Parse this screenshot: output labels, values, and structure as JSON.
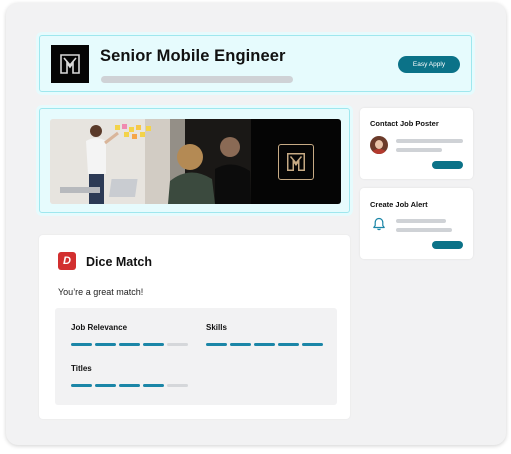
{
  "header": {
    "title": "Senior Mobile Engineer",
    "apply_label": "Easy Apply"
  },
  "sidebar": {
    "contact": {
      "title": "Contact Job Poster"
    },
    "alert": {
      "title": "Create Job Alert"
    }
  },
  "match": {
    "title": "Dice Match",
    "badge": "D",
    "subtitle": "You’re a great match!",
    "criteria": [
      {
        "label": "Job Relevance",
        "filled": 4,
        "total": 5
      },
      {
        "label": "Skills",
        "filled": 5,
        "total": 5
      },
      {
        "label": "Titles",
        "filled": 4,
        "total": 5
      }
    ]
  },
  "colors": {
    "accent": "#0b7288",
    "highlight_bg": "#e6fbfd",
    "highlight_border": "#9fe7ee",
    "dice_red": "#d22f2f",
    "segment_on": "#1b86a7",
    "segment_off": "#d5d7da"
  },
  "icons": {
    "company_logo": "company-logo-icon",
    "bell": "bell-icon",
    "avatar": "avatar"
  }
}
